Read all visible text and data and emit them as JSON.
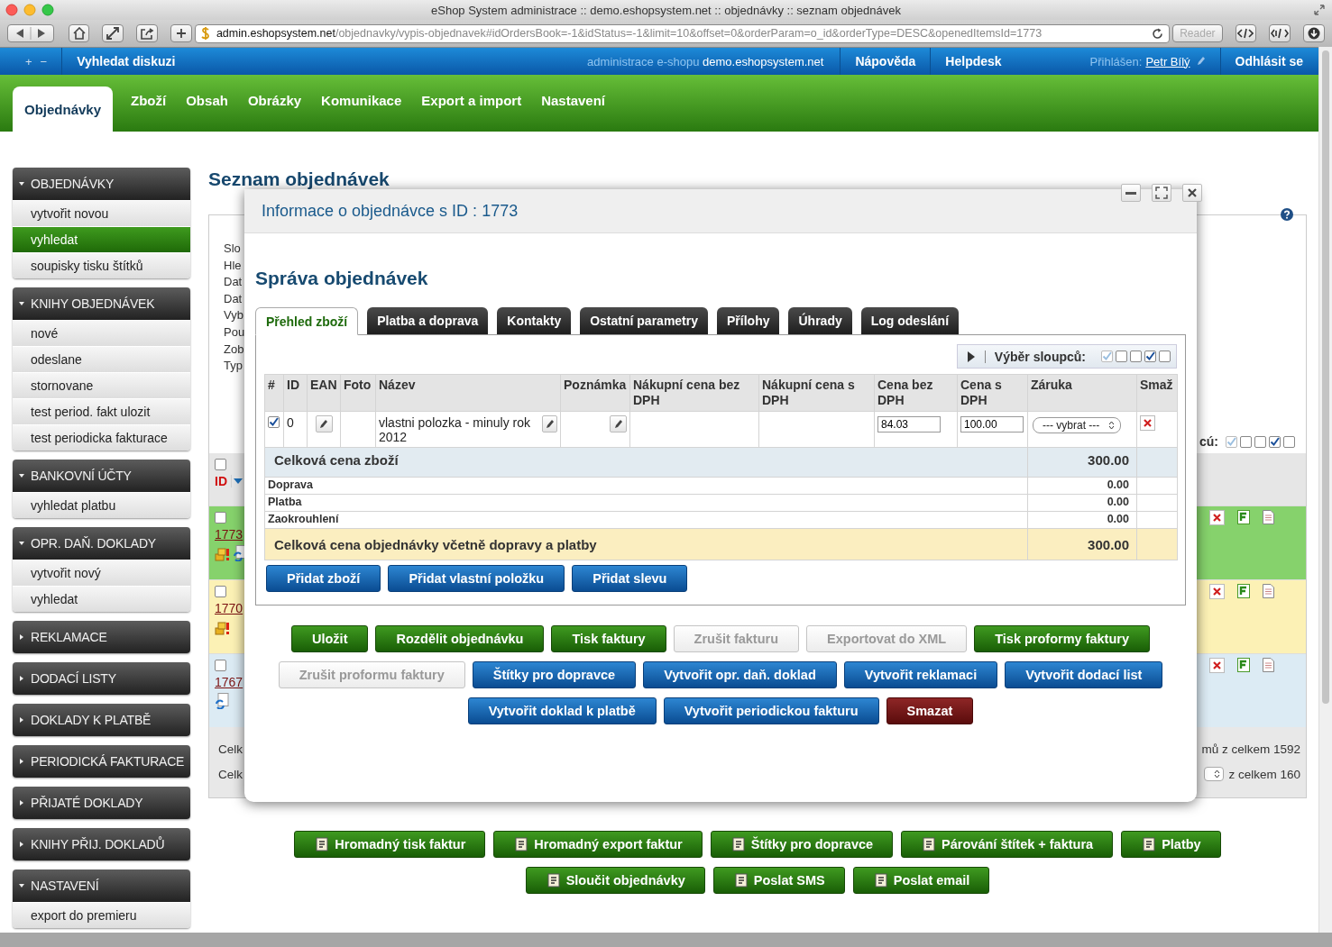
{
  "browser": {
    "title": "eShop System administrace :: demo.eshopsystem.net :: objednávky :: seznam objednávek",
    "url_host": "admin.eshopsystem.net",
    "url_path": "/objednavky/vypis-objednavek#idOrdersBook=-1&idStatus=-1&limit=10&offset=0&orderParam=o_id&orderType=DESC&openedItemsId=1773",
    "reader": "Reader"
  },
  "topbar": {
    "expand": "+",
    "collapse": "−",
    "search_link": "Vyhledat diskuzi",
    "site_label": "administrace e-shopu",
    "site_name": "demo.eshopsystem.net",
    "links": [
      "Nápověda",
      "Helpdesk"
    ],
    "logged_label": "Přihlášen:",
    "user": "Petr Bílý",
    "logout": "Odhlásit se"
  },
  "nav": [
    {
      "label": "Objednávky",
      "selected": true
    },
    {
      "label": "Zboží",
      "selected": false
    },
    {
      "label": "Obsah",
      "selected": false
    },
    {
      "label": "Obrázky",
      "selected": false
    },
    {
      "label": "Komunikace",
      "selected": false
    },
    {
      "label": "Export a import",
      "selected": false
    },
    {
      "label": "Nastavení",
      "selected": false
    }
  ],
  "sidebar": [
    {
      "title": "OBJEDNÁVKY",
      "expanded": true,
      "items": [
        {
          "label": "vytvořit novou",
          "selected": false
        },
        {
          "label": "vyhledat",
          "selected": true
        },
        {
          "label": "soupisky tisku štítků",
          "selected": false
        }
      ]
    },
    {
      "title": "KNIHY OBJEDNÁVEK",
      "expanded": true,
      "items": [
        {
          "label": "nové",
          "selected": false
        },
        {
          "label": "odeslane",
          "selected": false
        },
        {
          "label": "stornovane",
          "selected": false
        },
        {
          "label": "test period. fakt ulozit",
          "selected": false
        },
        {
          "label": "test periodicka fakturace",
          "selected": false
        }
      ]
    },
    {
      "title": "BANKOVNÍ ÚČTY",
      "expanded": true,
      "items": [
        {
          "label": "vyhledat platbu",
          "selected": false
        }
      ]
    },
    {
      "title": "OPR. DAŇ. DOKLADY",
      "expanded": true,
      "items": [
        {
          "label": "vytvořit nový",
          "selected": false
        },
        {
          "label": "vyhledat",
          "selected": false
        }
      ]
    },
    {
      "title": "REKLAMACE",
      "expanded": false
    },
    {
      "title": "DODACÍ LISTY",
      "expanded": false
    },
    {
      "title": "DOKLADY K PLATBĚ",
      "expanded": false
    },
    {
      "title": "PERIODICKÁ FAKTURACE",
      "expanded": false
    },
    {
      "title": "PŘIJATÉ DOKLADY",
      "expanded": false
    },
    {
      "title": "KNIHY PŘIJ. DOKLADŮ",
      "expanded": false
    },
    {
      "title": "NASTAVENÍ",
      "expanded": true,
      "items": [
        {
          "label": "export do premieru",
          "selected": false
        }
      ]
    }
  ],
  "page": {
    "heading": "Seznam objednávek",
    "filter_labels": [
      "Slo",
      "Hle",
      "Dat",
      "Dat",
      "Vyb",
      "Pou",
      "Zob",
      "Typ"
    ],
    "select_all": false,
    "id_header": "ID",
    "columns_label": "cú:",
    "column_checks": [
      {
        "checked": true,
        "disabled": true
      },
      {
        "checked": false,
        "disabled": false
      },
      {
        "checked": false,
        "disabled": false
      },
      {
        "checked": true,
        "disabled": false
      },
      {
        "checked": false,
        "disabled": false
      }
    ],
    "rows": [
      {
        "id": "1773",
        "checked": false,
        "color": "#86d26c",
        "warning": true,
        "synced": true
      },
      {
        "id": "1770",
        "checked": false,
        "color": "#fcf1b5",
        "warning": true,
        "synced": false
      },
      {
        "id": "1767",
        "checked": false,
        "color": "#dcebf4",
        "warning": false,
        "synced": true
      }
    ],
    "footer": [
      {
        "label": "Celk",
        "summary": "mů z celkem 1592",
        "kind": "text"
      },
      {
        "label": "Celk",
        "summary": "z celkem 160",
        "kind": "pager"
      }
    ]
  },
  "modal": {
    "title": "Informace o objednávce s ID : 1773",
    "heading": "Správa objednávek",
    "tabs": [
      {
        "label": "Přehled zboží",
        "selected": true
      },
      {
        "label": "Platba a doprava",
        "selected": false
      },
      {
        "label": "Kontakty",
        "selected": false
      },
      {
        "label": "Ostatní parametry",
        "selected": false
      },
      {
        "label": "Přílohy",
        "selected": false
      },
      {
        "label": "Úhrady",
        "selected": false
      },
      {
        "label": "Log odeslání",
        "selected": false
      }
    ],
    "column_picker": {
      "label": "Výběr sloupců:",
      "checks": [
        {
          "checked": true,
          "disabled": true
        },
        {
          "checked": false,
          "disabled": false
        },
        {
          "checked": false,
          "disabled": false
        },
        {
          "checked": true,
          "disabled": false
        },
        {
          "checked": false,
          "disabled": false
        }
      ]
    },
    "table": {
      "columns": [
        "#",
        "ID",
        "EAN",
        "Foto",
        "Název",
        "Poznámka",
        "Nákupní cena bez DPH",
        "Nákupní cena s DPH",
        "Cena bez DPH",
        "Cena s DPH",
        "Záruka",
        "Smaž"
      ],
      "rows": [
        {
          "checked": true,
          "id": "0",
          "name": "vlastni polozka - minuly rok 2012",
          "price_net": "84.03",
          "price_gross": "100.00",
          "warranty": "--- vybrat ---"
        }
      ],
      "totals": [
        {
          "label": "Celková cena zboží",
          "value": "300.00",
          "kind": "subtotal"
        },
        {
          "label": "Doprava",
          "value": "0.00",
          "kind": "line"
        },
        {
          "label": "Platba",
          "value": "0.00",
          "kind": "line"
        },
        {
          "label": "Zaokrouhlení",
          "value": "0.00",
          "kind": "line"
        },
        {
          "label": "Celková cena objednávky včetně dopravy a platby",
          "value": "300.00",
          "kind": "total"
        }
      ]
    },
    "add_buttons": [
      "Přidat zboží",
      "Přidat vlastní položku",
      "Přidat slevu"
    ],
    "action_rows": [
      [
        {
          "label": "Uložit",
          "kind": "green",
          "disabled": false
        },
        {
          "label": "Rozdělit objednávku",
          "kind": "green",
          "disabled": false
        },
        {
          "label": "Tisk faktury",
          "kind": "green",
          "disabled": false
        },
        {
          "label": "Zrušit fakturu",
          "kind": "green",
          "disabled": true
        },
        {
          "label": "Exportovat do XML",
          "kind": "green",
          "disabled": true
        },
        {
          "label": "Tisk proformy faktury",
          "kind": "green",
          "disabled": false
        }
      ],
      [
        {
          "label": "Zrušit proformu faktury",
          "kind": "blue",
          "disabled": true
        },
        {
          "label": "Štítky pro dopravce",
          "kind": "blue",
          "disabled": false
        },
        {
          "label": "Vytvořit opr. daň. doklad",
          "kind": "blue",
          "disabled": false
        },
        {
          "label": "Vytvořit reklamaci",
          "kind": "blue",
          "disabled": false
        },
        {
          "label": "Vytvořit dodací list",
          "kind": "blue",
          "disabled": false
        }
      ],
      [
        {
          "label": "Vytvořit doklad k platbě",
          "kind": "blue",
          "disabled": false
        },
        {
          "label": "Vytvořit periodickou fakturu",
          "kind": "blue",
          "disabled": false
        },
        {
          "label": "Smazat",
          "kind": "danger",
          "disabled": false
        }
      ]
    ]
  },
  "bulk_rows": [
    [
      "Hromadný tisk faktur",
      "Hromadný export faktur",
      "Štítky pro dopravce",
      "Párování štítek + faktura",
      "Platby"
    ],
    [
      "Sloučit objednávky",
      "Poslat SMS",
      "Poslat email"
    ]
  ]
}
